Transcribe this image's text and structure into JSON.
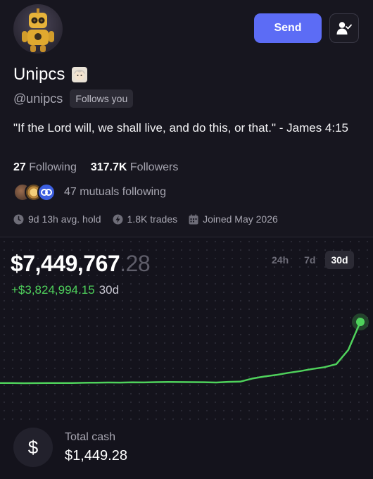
{
  "profile": {
    "name": "Unipcs",
    "handle": "@unipcs",
    "follows_badge": "Follows you",
    "bio": "\"If the Lord will, we shall live, and do this, or that.\" - James 4:15",
    "following_count": "27",
    "following_label": "Following",
    "followers_count": "317.7K",
    "followers_label": "Followers",
    "mutuals_text": "47 mutuals following",
    "avg_hold": "9d 13h avg. hold",
    "trades": "1.8K trades",
    "joined": "Joined May 2026"
  },
  "actions": {
    "send_label": "Send",
    "follow_icon": "user-check-icon"
  },
  "portfolio": {
    "balance_main": "$7,449,767",
    "balance_cents": ".28",
    "change": "+$3,824,994.15",
    "change_period": "30d",
    "ranges": [
      "24h",
      "7d",
      "30d"
    ],
    "active_range": "30d",
    "line_color": "#4fd25c"
  },
  "chart_data": {
    "type": "line",
    "title": "",
    "xlabel": "",
    "ylabel": "",
    "grid": false,
    "series": [
      {
        "values": [
          3624773,
          3626000,
          3615000,
          3620000,
          3630000,
          3625000,
          3628000,
          3640000,
          3650000,
          3660000,
          3655000,
          3670000,
          3665000,
          3680000,
          3690000,
          3685000,
          3680000,
          3675000,
          3660000,
          3700000,
          3710000,
          3905000,
          4035000,
          4130000,
          4265000,
          4375000,
          4505000,
          4615000,
          4810000,
          5700000,
          7449767
        ]
      }
    ]
  },
  "cash": {
    "label": "Total cash",
    "value": "$1,449.28",
    "icon": "dollar-icon"
  }
}
